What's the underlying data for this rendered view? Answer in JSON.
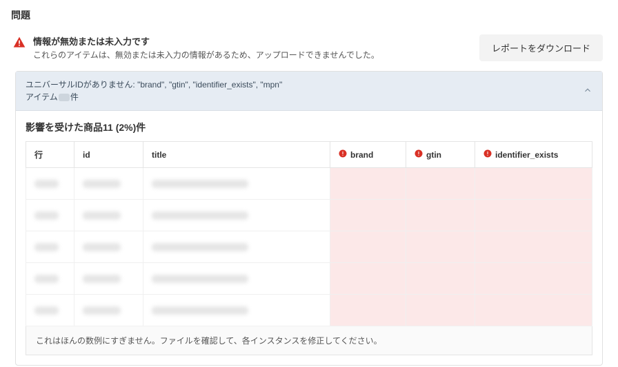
{
  "page_title": "問題",
  "alert": {
    "title": "情報が無効または未入力です",
    "description": "これらのアイテムは、無効または未入力の情報があるため、アップロードできませんでした。"
  },
  "download_button": "レポートをダウンロード",
  "accordion": {
    "header_line1": "ユニバーサルIDがありません: \"brand\", \"gtin\", \"identifier_exists\", \"mpn\"",
    "header_line2_prefix": "アイテム",
    "header_line2_suffix": "件"
  },
  "affected": {
    "title": "影響を受けた商品11 (2%)件"
  },
  "table": {
    "headers": {
      "row": "行",
      "id": "id",
      "title": "title",
      "brand": "brand",
      "gtin": "gtin",
      "identifier_exists": "identifier_exists"
    },
    "footer_note": "これはほんの数例にすぎません。ファイルを確認して、各インスタンスを修正してください。"
  }
}
